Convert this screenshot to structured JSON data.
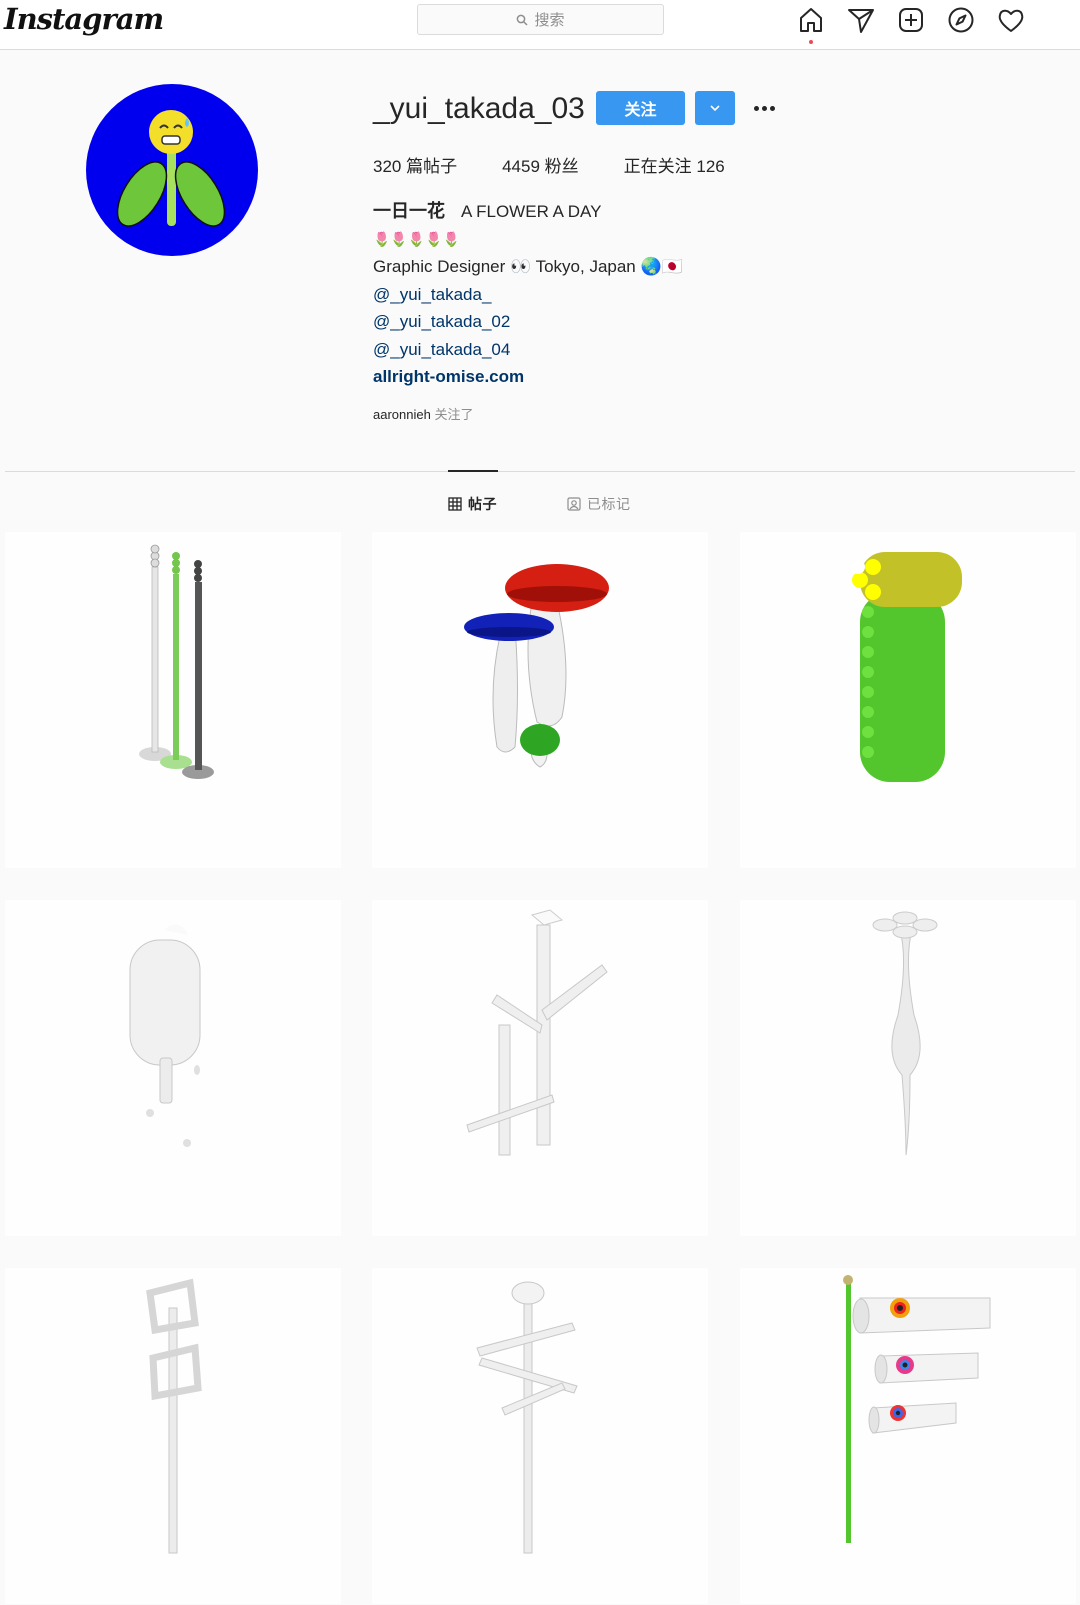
{
  "nav": {
    "logo": "Instagram",
    "search_placeholder": "搜索",
    "icons": [
      "home-icon",
      "direct-icon",
      "new-post-icon",
      "explore-icon",
      "activity-icon"
    ]
  },
  "profile": {
    "username": "_yui_takada_03",
    "follow_label": "关注",
    "stats": {
      "posts": "320 篇帖子",
      "followers": "4459 粉丝",
      "following": "正在关注 126"
    },
    "bio": {
      "name": "一日一花",
      "name_en": "A FLOWER A DAY",
      "emoji_line": "🌷🌷🌷🌷🌷",
      "line1": "Graphic Designer 👀 Tokyo, Japan 🌏🇯🇵",
      "mentions": [
        "@_yui_takada_",
        "@_yui_takada_02",
        "@_yui_takada_04"
      ],
      "website": "allright-omise.com"
    },
    "followed_by_user": "aaronnieh",
    "followed_by_label": "关注了"
  },
  "tabs": [
    {
      "label": "帖子",
      "icon": "grid-icon",
      "active": true
    },
    {
      "label": "已标记",
      "icon": "tagged-icon",
      "active": false
    }
  ],
  "colors": {
    "accent": "#3897f0",
    "avatar_bg": "#0000ee",
    "link": "#003569"
  },
  "posts": [
    "three-poles",
    "mushrooms",
    "green-corn",
    "popsicle",
    "branches",
    "white-flower",
    "square-frames",
    "zigzag-pole",
    "koinobori"
  ]
}
